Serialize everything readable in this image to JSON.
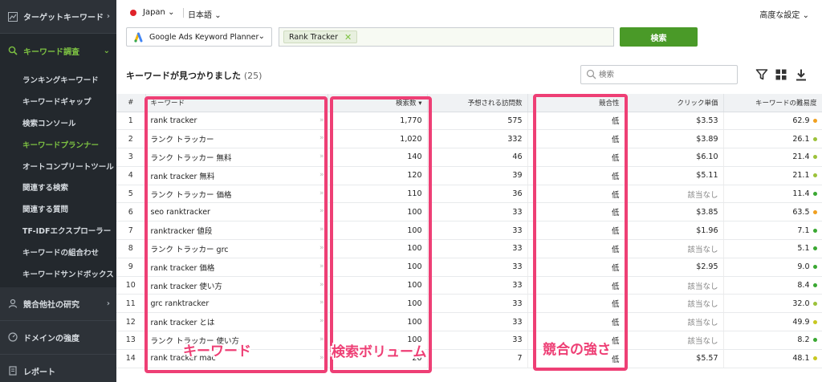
{
  "sidebar": {
    "group_target": "ターゲットキーワード",
    "group_research": "キーワード調査",
    "items": [
      {
        "label": "ランキングキーワード"
      },
      {
        "label": "キーワードギャップ"
      },
      {
        "label": "検索コンソール"
      },
      {
        "label": "キーワードプランナー",
        "active": true
      },
      {
        "label": "オートコンプリートツール"
      },
      {
        "label": "関連する検索"
      },
      {
        "label": "関連する質問"
      },
      {
        "label": "TF-IDFエクスプローラー"
      },
      {
        "label": "キーワードの組合わせ"
      },
      {
        "label": "キーワードサンドボックス"
      }
    ],
    "group_competitor": "競合他社の研究",
    "group_domain": "ドメインの強度",
    "group_report": "レポート"
  },
  "topbar": {
    "country": "Japan",
    "language": "日本語",
    "advanced": "高度な設定"
  },
  "search": {
    "source": "Google Ads Keyword Planner",
    "tag": "Rank Tracker",
    "button": "検索",
    "filter_placeholder": "検索"
  },
  "results": {
    "title": "キーワードが見つかりました",
    "count": "(25)"
  },
  "table": {
    "headers": {
      "index": "#",
      "keyword": "キーワード",
      "volume": "検索数",
      "visits": "予想される訪問数",
      "competition": "競合性",
      "cpc": "クリック単価",
      "difficulty": "キーワードの難易度"
    },
    "rows": [
      {
        "n": "1",
        "kw": "rank tracker",
        "vol": "1,770",
        "visits": "575",
        "comp": "低",
        "cpc": "$3.53",
        "diff": "62.9",
        "color": "#f0a020"
      },
      {
        "n": "2",
        "kw": "ランク トラッカー",
        "vol": "1,020",
        "visits": "332",
        "comp": "低",
        "cpc": "$3.89",
        "diff": "26.1",
        "color": "#9cc23a"
      },
      {
        "n": "3",
        "kw": "ランク トラッカー 無料",
        "vol": "140",
        "visits": "46",
        "comp": "低",
        "cpc": "$6.10",
        "diff": "21.4",
        "color": "#9cc23a"
      },
      {
        "n": "4",
        "kw": "rank tracker 無料",
        "vol": "120",
        "visits": "39",
        "comp": "低",
        "cpc": "$5.11",
        "diff": "21.1",
        "color": "#9cc23a"
      },
      {
        "n": "5",
        "kw": "ランク トラッカー 価格",
        "vol": "110",
        "visits": "36",
        "comp": "低",
        "cpc": "該当なし",
        "diff": "11.4",
        "color": "#3aa832"
      },
      {
        "n": "6",
        "kw": "seo ranktracker",
        "vol": "100",
        "visits": "33",
        "comp": "低",
        "cpc": "$3.85",
        "diff": "63.5",
        "color": "#f0a020"
      },
      {
        "n": "7",
        "kw": "ranktracker 値段",
        "vol": "100",
        "visits": "33",
        "comp": "低",
        "cpc": "$1.96",
        "diff": "7.1",
        "color": "#3aa832"
      },
      {
        "n": "8",
        "kw": "ランク トラッカー grc",
        "vol": "100",
        "visits": "33",
        "comp": "低",
        "cpc": "該当なし",
        "diff": "5.1",
        "color": "#3aa832"
      },
      {
        "n": "9",
        "kw": "rank tracker 価格",
        "vol": "100",
        "visits": "33",
        "comp": "低",
        "cpc": "$2.95",
        "diff": "9.0",
        "color": "#3aa832"
      },
      {
        "n": "10",
        "kw": "rank tracker 使い方",
        "vol": "100",
        "visits": "33",
        "comp": "低",
        "cpc": "該当なし",
        "diff": "8.4",
        "color": "#3aa832"
      },
      {
        "n": "11",
        "kw": "grc ranktracker",
        "vol": "100",
        "visits": "33",
        "comp": "低",
        "cpc": "該当なし",
        "diff": "32.0",
        "color": "#9cc23a"
      },
      {
        "n": "12",
        "kw": "rank tracker とは",
        "vol": "100",
        "visits": "33",
        "comp": "低",
        "cpc": "該当なし",
        "diff": "49.9",
        "color": "#c8c820"
      },
      {
        "n": "13",
        "kw": "ランク トラッカー 使い方",
        "vol": "100",
        "visits": "33",
        "comp": "低",
        "cpc": "該当なし",
        "diff": "8.2",
        "color": "#3aa832"
      },
      {
        "n": "14",
        "kw": "rank tracker mac",
        "vol": "20",
        "visits": "7",
        "comp": "低",
        "cpc": "$5.57",
        "diff": "48.1",
        "color": "#c8c820"
      }
    ]
  },
  "annotations": {
    "keyword": "キーワード",
    "volume": "検索ボリューム",
    "competition": "競合の強さ",
    "color": "#ee3f75"
  }
}
